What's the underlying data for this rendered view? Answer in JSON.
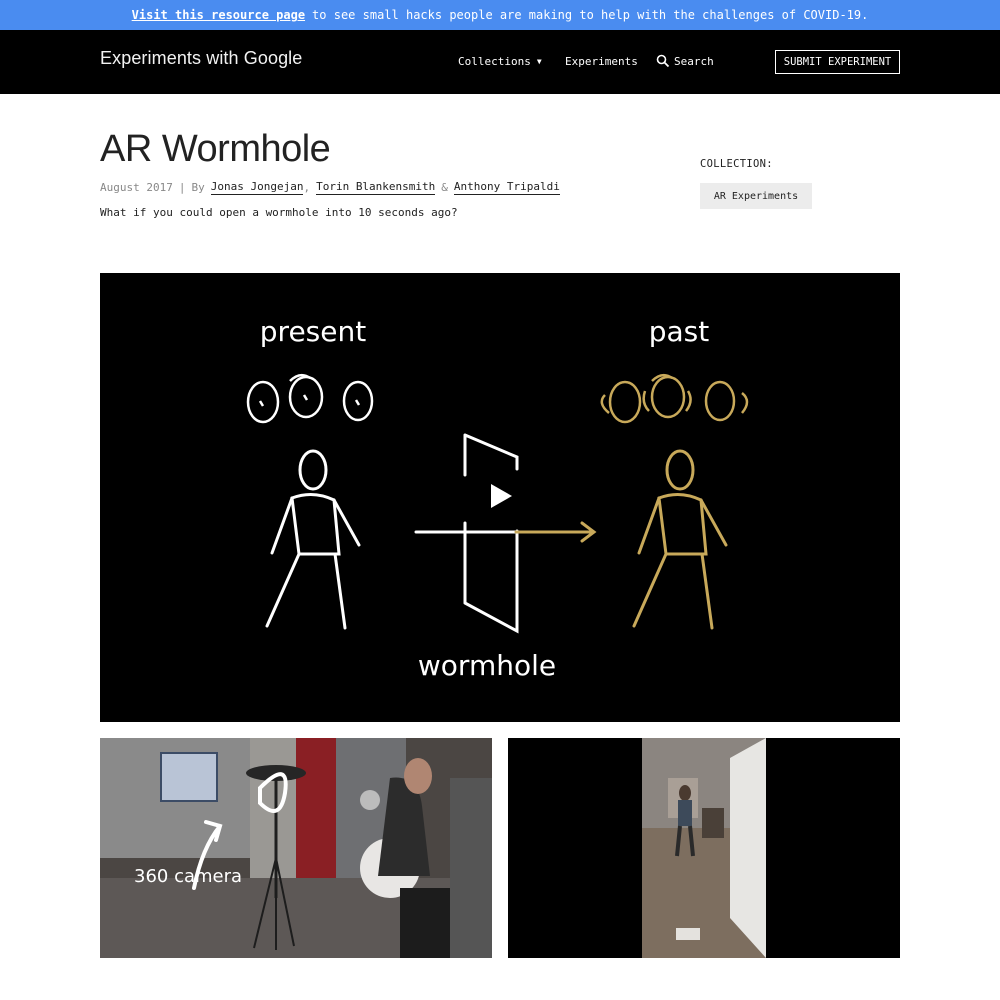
{
  "banner": {
    "link_text": "Visit this resource page",
    "rest_text": "to see small hacks people are making to help with the challenges of COVID-19."
  },
  "nav": {
    "brand": "Experiments with Google",
    "collections": "Collections",
    "experiments": "Experiments",
    "search": "Search",
    "submit": "SUBMIT EXPERIMENT"
  },
  "article": {
    "title": "AR Wormhole",
    "date": "August 2017",
    "by": "By",
    "authors": [
      "Jonas Jongejan",
      "Torin Blankensmith",
      "Anthony Tripaldi"
    ],
    "description": "What if you could open a wormhole into 10 seconds ago?",
    "collection_label": "COLLECTION:",
    "collection_tag": "AR Experiments"
  },
  "hero": {
    "present": "present",
    "past": "past",
    "wormhole": "wormhole",
    "drawing_color": "#ffffff",
    "past_color": "#c8a95a"
  },
  "media": {
    "camera_label": "360 camera"
  },
  "colors": {
    "banner": "#4a8cf0",
    "nav": "#000000"
  }
}
